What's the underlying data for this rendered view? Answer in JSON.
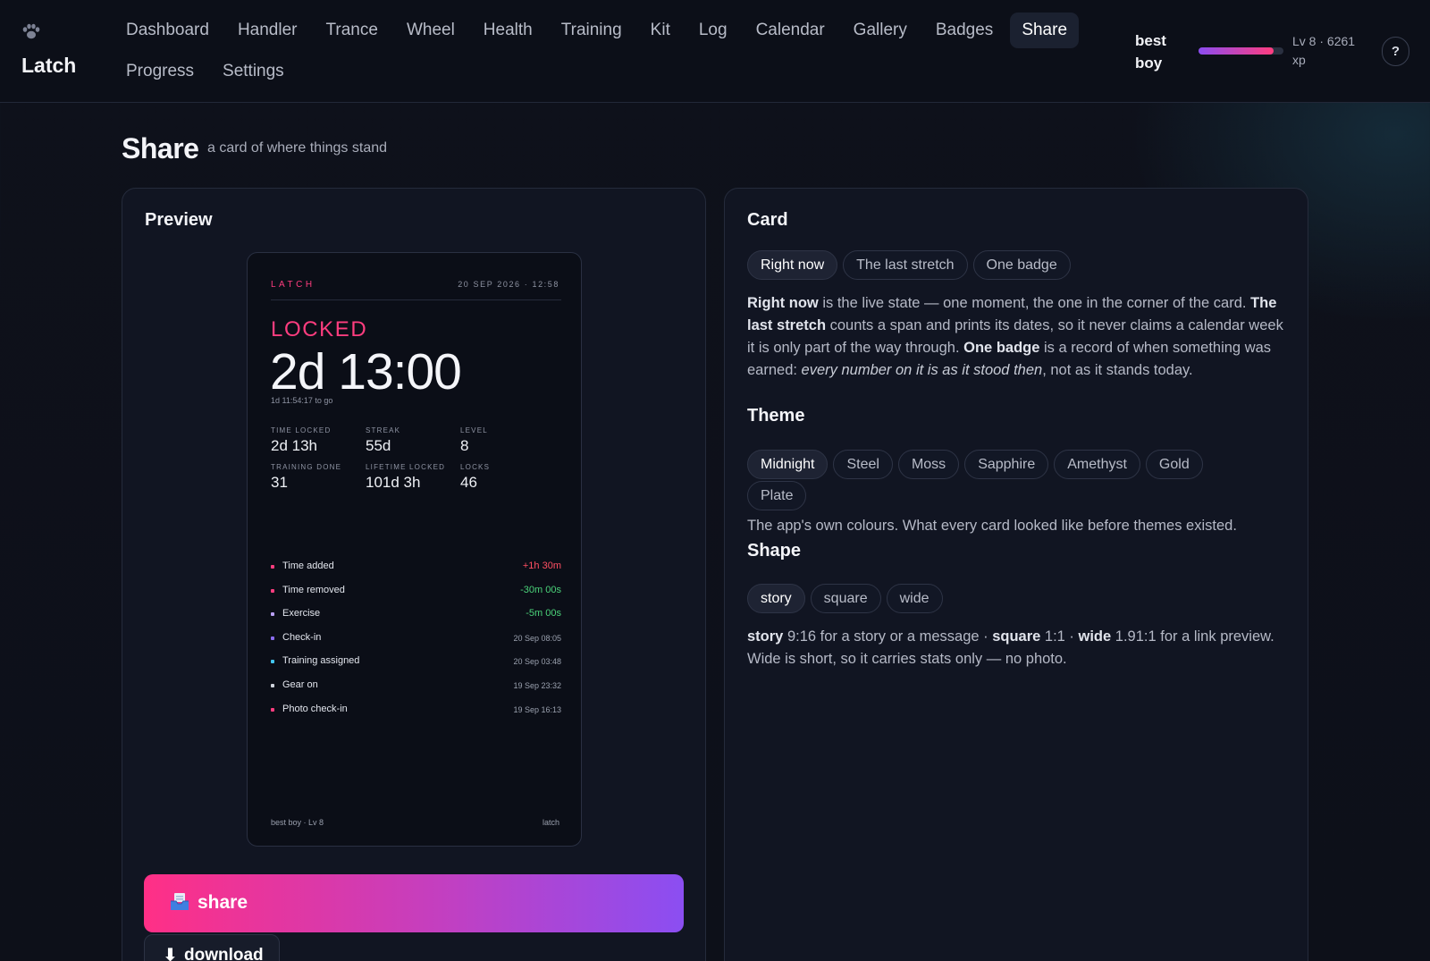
{
  "app": {
    "name": "Latch"
  },
  "nav": {
    "items": [
      "Dashboard",
      "Handler",
      "Trance",
      "Wheel",
      "Health",
      "Training",
      "Kit",
      "Log",
      "Calendar",
      "Gallery",
      "Badges",
      "Share"
    ],
    "items_row2": [
      "Progress",
      "Settings"
    ],
    "active": "Share"
  },
  "user": {
    "name": "best boy",
    "level_text": "Lv 8 · 6261 xp",
    "xp_progress": 0.88,
    "help": "?"
  },
  "page": {
    "title": "Share",
    "subtitle": "a card of where things stand"
  },
  "preview": {
    "title": "Preview",
    "card": {
      "brand": "LATCH",
      "datetime": "20 SEP 2026 · 12:58",
      "status": "LOCKED",
      "timer": "2d 13:00",
      "to_go": "1d 11:54:17 to go",
      "stats": [
        {
          "label": "TIME LOCKED",
          "value": "2d 13h"
        },
        {
          "label": "STREAK",
          "value": "55d"
        },
        {
          "label": "LEVEL",
          "value": "8"
        },
        {
          "label": "TRAINING DONE",
          "value": "31"
        },
        {
          "label": "LIFETIME LOCKED",
          "value": "101d 3h"
        },
        {
          "label": "LOCKS",
          "value": "46"
        }
      ],
      "events": [
        {
          "label": "Time added",
          "value": "+1h 30m",
          "dot": "#ff3d7f",
          "value_color": "#ff4f62"
        },
        {
          "label": "Time removed",
          "value": "-30m 00s",
          "dot": "#ff3d7f",
          "value_color": "#4bd37a"
        },
        {
          "label": "Exercise",
          "value": "-5m 00s",
          "dot": "#b9a0f5",
          "value_color": "#4bd37a"
        },
        {
          "label": "Check-in",
          "value": "20 Sep 08:05",
          "dot": "#8b6cf0",
          "value_color": "#9aa0ae"
        },
        {
          "label": "Training assigned",
          "value": "20 Sep 03:48",
          "dot": "#43c6f0",
          "value_color": "#9aa0ae"
        },
        {
          "label": "Gear on",
          "value": "19 Sep 23:32",
          "dot": "#cfd3dc",
          "value_color": "#9aa0ae"
        },
        {
          "label": "Photo check-in",
          "value": "19 Sep 16:13",
          "dot": "#ff3d7f",
          "value_color": "#9aa0ae"
        }
      ],
      "footer_left": "best boy · Lv 8",
      "footer_right": "latch"
    },
    "share_label": "share",
    "download_label": "download"
  },
  "settings": {
    "card": {
      "title": "Card",
      "options": [
        "Right now",
        "The last stretch",
        "One badge"
      ],
      "active": "Right now"
    },
    "theme": {
      "title": "Theme",
      "options": [
        "Midnight",
        "Steel",
        "Moss",
        "Sapphire",
        "Amethyst",
        "Gold",
        "Plate"
      ],
      "active": "Midnight",
      "description": "The app's own colours. What every card looked like before themes existed."
    },
    "shape": {
      "title": "Shape",
      "options": [
        "story",
        "square",
        "wide"
      ],
      "active": "story"
    }
  },
  "colors": {
    "accent": "#ff3d7f",
    "accent2": "#8b4ef2",
    "bg": "#0e111b",
    "panel": "#111522"
  }
}
